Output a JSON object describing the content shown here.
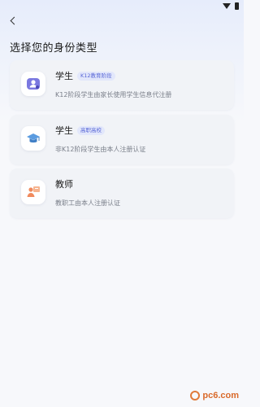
{
  "page": {
    "title": "选择您的身份类型"
  },
  "status_bar": {
    "icons": [
      "wifi-icon",
      "battery-icon"
    ]
  },
  "cards": [
    {
      "title": "学生",
      "tag": "K12教育阶段",
      "desc": "K12阶段学生由家长使用学生信息代注册",
      "icon": "student-user-icon",
      "icon_color": "#6e6bd6"
    },
    {
      "title": "学生",
      "tag": "高职高校",
      "desc": "非K12阶段学生由本人注册认证",
      "icon": "graduation-cap-icon",
      "icon_color": "#4a8fd8"
    },
    {
      "title": "教师",
      "tag": "",
      "desc": "教职工由本人注册认证",
      "icon": "teacher-icon",
      "icon_color": "#f08a5d"
    }
  ],
  "watermark": {
    "text": "pc6.com"
  },
  "colors": {
    "accent": "#5866d6",
    "tag_bg": "#e2e7fb",
    "card_bg": "#f1f3f7",
    "page_bg": "#f7f8fb"
  }
}
